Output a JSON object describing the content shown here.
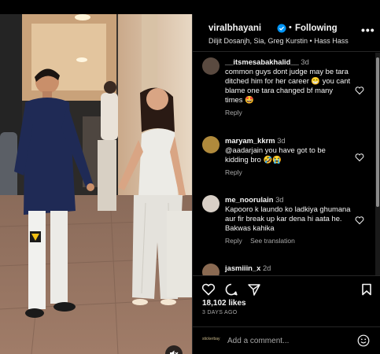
{
  "post": {
    "username": "viralbhayani",
    "separator": "•",
    "follow_label": "Following",
    "audio_line": "Diljit Dosanjh, Sia, Greg Kurstin • Hass Hass",
    "more_label": "•••"
  },
  "comments": [
    {
      "user": "__itsmesabakhalid__",
      "time": "3d",
      "text": "common guys dont judge may be tara ditched him for her career 😁 you cant blame one tara changed bf many times 🤩",
      "reply_label": "Reply",
      "avatar_color": "#5a4a40"
    },
    {
      "user": "maryam_kkrm",
      "time": "3d",
      "text": "@aadarjain you have got to be kidding bro 🤣😭",
      "reply_label": "Reply",
      "avatar_color": "#b08a3c"
    },
    {
      "user": "me_noorulain",
      "time": "3d",
      "text": "Kapooro k laundo ko ladkiya ghumana aur fir break up kar dena hi aata he. Bakwas kahika",
      "reply_label": "Reply",
      "translation_label": "See translation",
      "avatar_color": "#d8cfc6"
    },
    {
      "user": "jasmiiin_x",
      "time": "2d",
      "avatar_color": "#8a6a52"
    }
  ],
  "likes": "18,102 likes",
  "date": "3 DAYS AGO",
  "comment_input": {
    "placeholder": "Add a comment...",
    "sticker_text": "stickerbay"
  },
  "colors": {
    "background": "#000000",
    "text": "#f5f5f5",
    "muted": "#a8a8a8",
    "divider": "#262626",
    "verified": "#0095f6"
  },
  "icons": {
    "verified": "verified-badge-icon",
    "like": "heart-icon",
    "comment": "comment-bubble-icon",
    "share": "paper-plane-icon",
    "save": "bookmark-icon",
    "mute": "speaker-muted-icon",
    "emoji": "smiley-icon"
  }
}
